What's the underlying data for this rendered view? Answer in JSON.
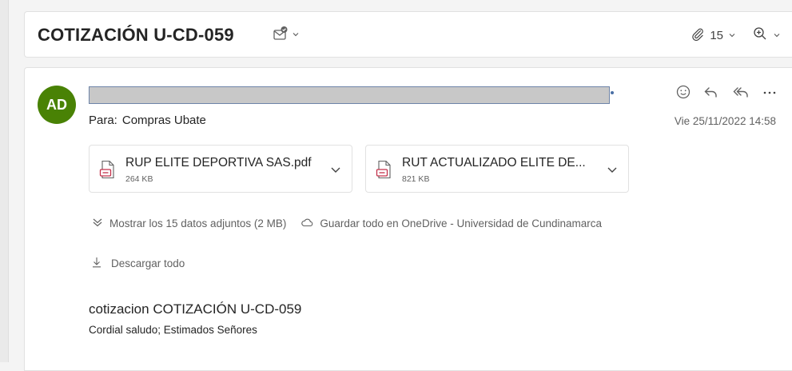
{
  "subject": {
    "title": "COTIZACIÓN U-CD-059",
    "attachment_count": "15"
  },
  "message": {
    "avatar_initials": "AD",
    "to_label": "Para:",
    "to_value": "Compras Ubate",
    "date": "Vie 25/11/2022 14:58"
  },
  "attachments": [
    {
      "name": "RUP ELITE DEPORTIVA SAS.pdf",
      "size": "264 KB"
    },
    {
      "name": "RUT ACTUALIZADO ELITE DE...",
      "size": "821 KB"
    }
  ],
  "actions": {
    "show_all": "Mostrar los 15 datos adjuntos (2 MB)",
    "save_onedrive": "Guardar todo en OneDrive - Universidad de Cundinamarca",
    "download_all": "Descargar todo"
  },
  "body": {
    "title": "cotizacion  COTIZACIÓN U-CD-059",
    "line1": "Cordial saludo; Estimados Señores"
  },
  "colors": {
    "avatar_bg": "#498205",
    "background": "#f4f4f4",
    "icon": "#616161",
    "pdf_red": "#c4314b"
  }
}
